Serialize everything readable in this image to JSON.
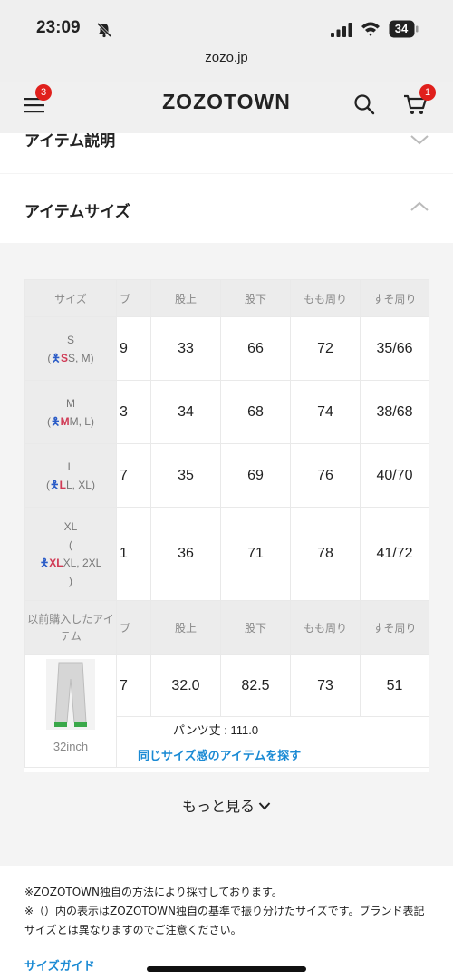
{
  "status_bar": {
    "time": "23:09",
    "battery": "34"
  },
  "browser": {
    "url": "zozo.jp"
  },
  "header": {
    "logo": "ZOZOTOWN",
    "menu_badge": "3",
    "cart_badge": "1"
  },
  "sections": {
    "item_description": "アイテム説明",
    "item_size": "アイテムサイズ"
  },
  "size_table": {
    "headers": [
      "サイズ",
      "プ",
      "股上",
      "股下",
      "もも周り",
      "すそ周り"
    ],
    "rows": [
      {
        "size": "S",
        "equiv_a": "S",
        "equiv_b": "S, M",
        "cut": "9",
        "rise": "33",
        "inseam": "66",
        "thigh": "72",
        "hem": "35/66"
      },
      {
        "size": "M",
        "equiv_a": "M",
        "equiv_b": "M, L",
        "cut": "3",
        "rise": "34",
        "inseam": "68",
        "thigh": "74",
        "hem": "38/68"
      },
      {
        "size": "L",
        "equiv_a": "L",
        "equiv_b": "L, XL",
        "cut": "7",
        "rise": "35",
        "inseam": "69",
        "thigh": "76",
        "hem": "40/70"
      },
      {
        "size": "XL",
        "equiv_a": "XL",
        "equiv_b": "XL, 2XL",
        "cut": "1",
        "rise": "36",
        "inseam": "71",
        "thigh": "78",
        "hem": "41/72"
      }
    ],
    "previous": {
      "header_label": "以前購入したアイテム",
      "headers": [
        "プ",
        "股上",
        "股下",
        "もも周り",
        "すそ周り"
      ],
      "item_label": "32inch",
      "cut": "7",
      "rise": "32.0",
      "inseam": "82.5",
      "thigh": "73",
      "hem": "51",
      "pants_length": "パンツ丈 : 111.0",
      "similar_link": "同じサイズ感のアイテムを探す"
    }
  },
  "more_button": "もっと見る",
  "notes": [
    "※ZOZOTOWN独自の方法により採寸しております。",
    "※（）内の表示はZOZOTOWN独自の基準で振り分けたサイズです。ブランド表記サイズとは異なりますのでご注意ください。"
  ],
  "size_guide_link": "サイズガイド",
  "colors": {
    "accent_link": "#1a8ad4",
    "badge": "#e0201c"
  }
}
